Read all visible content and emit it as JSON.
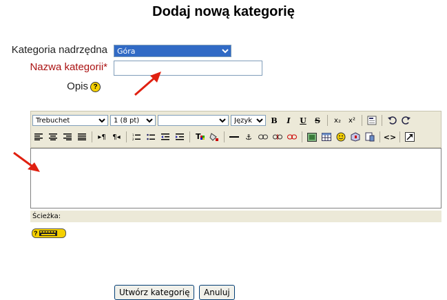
{
  "title": "Dodaj nową kategorię",
  "form": {
    "parent_label": "Kategoria nadrzędna",
    "parent_value": "Góra",
    "name_label": "Nazwa kategorii",
    "name_required_mark": "*",
    "name_value": "",
    "desc_label": "Opis",
    "help_symbol": "?"
  },
  "toolbar": {
    "font_family": "Trebuchet",
    "font_size": "1 (8 pt)",
    "format": "",
    "language": "Język",
    "bold": "B",
    "italic": "I",
    "underline": "U",
    "strike": "S",
    "subscript": "x₂",
    "superscript": "x²"
  },
  "editor": {
    "path_label": "Ścieżka:"
  },
  "buttons": {
    "create": "Utwórz kategorię",
    "cancel": "Anuluj"
  },
  "colors": {
    "required": "#aa1111",
    "arrow": "#e02010",
    "toolbar_bg": "#ece9d8"
  }
}
